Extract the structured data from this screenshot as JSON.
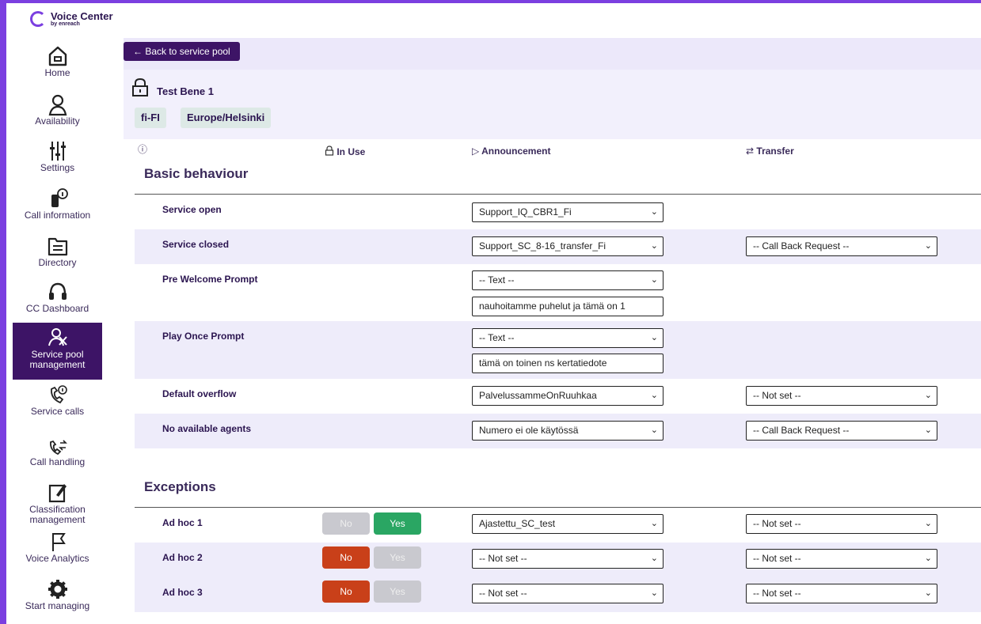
{
  "app": {
    "title": "Voice Center",
    "subtitle": "by enreach"
  },
  "sidebar": {
    "items": [
      {
        "label": "Home",
        "icon": "home-icon"
      },
      {
        "label": "Availability",
        "icon": "user-icon"
      },
      {
        "label": "Settings",
        "icon": "sliders-icon"
      },
      {
        "label": "Call information",
        "icon": "phone-info-icon"
      },
      {
        "label": "Directory",
        "icon": "folder-icon"
      },
      {
        "label": "CC Dashboard",
        "icon": "headset-icon"
      },
      {
        "label": "Service pool management",
        "icon": "users-icon"
      },
      {
        "label": "Service calls",
        "icon": "phone-call-info-icon"
      },
      {
        "label": "Call handling",
        "icon": "phone-transfer-icon"
      },
      {
        "label": "Classification management",
        "icon": "edit-note-icon"
      },
      {
        "label": "Voice Analytics",
        "icon": "flag-icon"
      },
      {
        "label": "Start managing",
        "icon": "gear-icon"
      }
    ],
    "active_index": 6
  },
  "main": {
    "back_label": "← Back to service pool",
    "pool_name": "Test Bene 1",
    "tags": [
      "fi-FI",
      "Europe/Helsinki"
    ],
    "columns": {
      "info": "ⓘ",
      "in_use": "In Use",
      "announcement": "Announcement",
      "transfer": "Transfer"
    },
    "basic_title": "Basic behaviour",
    "basic_rows": [
      {
        "label": "Service open",
        "announcement": "Support_IQ_CBR1_Fi",
        "transfer": null,
        "text": null
      },
      {
        "label": "Service closed",
        "announcement": "Support_SC_8-16_transfer_Fi",
        "transfer": "-- Call Back Request --",
        "text": null
      },
      {
        "label": "Pre Welcome Prompt",
        "announcement": "-- Text --",
        "transfer": null,
        "text": "nauhoitamme puhelut ja tämä on 1"
      },
      {
        "label": "Play Once Prompt",
        "announcement": "-- Text --",
        "transfer": null,
        "text": "tämä on toinen ns kertatiedote"
      },
      {
        "label": "Default overflow",
        "announcement": "PalvelussammeOnRuuhkaa",
        "transfer": "-- Not set --",
        "text": null
      },
      {
        "label": "No available agents",
        "announcement": "Numero ei ole käytössä",
        "transfer": "-- Call Back Request --",
        "text": null
      }
    ],
    "exceptions_title": "Exceptions",
    "exception_rows": [
      {
        "label": "Ad hoc 1",
        "no": "No",
        "yes": "Yes",
        "in_use": "Yes",
        "announcement": "Ajastettu_SC_test",
        "transfer": "-- Not set --"
      },
      {
        "label": "Ad hoc 2",
        "no": "No",
        "yes": "Yes",
        "in_use": "No",
        "announcement": "-- Not set --",
        "transfer": "-- Not set --"
      },
      {
        "label": "Ad hoc 3",
        "no": "No",
        "yes": "Yes",
        "in_use": "No",
        "announcement": "-- Not set --",
        "transfer": "-- Not set --"
      }
    ]
  },
  "colors": {
    "accent": "#3d1466",
    "brand": "#7b3fe0",
    "yes": "#2aa663",
    "no": "#c94019",
    "shade": "#eeecfa"
  }
}
